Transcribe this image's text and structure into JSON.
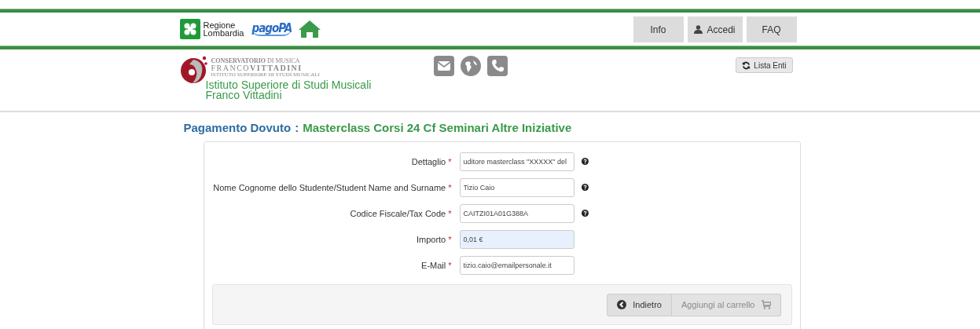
{
  "header": {
    "region_logo": {
      "line1": "Regione",
      "line2": "Lombardia"
    },
    "pagopa_logo": "pagoPA",
    "nav": [
      {
        "label": "Info",
        "kind": "text"
      },
      {
        "label": "Accedi",
        "kind": "user"
      },
      {
        "label": "FAQ",
        "kind": "text"
      }
    ]
  },
  "institution": {
    "logo_lines": [
      "**CONSERVATORIO** DI MUSICA",
      "FRANCO**VITTADINI**",
      "ISTITUTO SUPERIORE DI STUDI MUSICALI"
    ],
    "name_lines": [
      "Istituto Superiore di Studi Musicali",
      "Franco Vittadini"
    ],
    "contacts": [
      {
        "kind": "mail"
      },
      {
        "kind": "globe"
      },
      {
        "kind": "phone"
      }
    ],
    "list_button": "Lista Enti"
  },
  "title": {
    "prefix": "Pagamento Dovuto",
    "separator": ":",
    "name": "Masterclass Corsi 24 Cf Seminari Altre Iniziative"
  },
  "form": {
    "fields": [
      {
        "label": "Dettaglio",
        "required_mark": "*",
        "value": "uditore masterclass \"XXXXX\" del",
        "readonly": false,
        "help": true
      },
      {
        "label": "Nome Cognome dello Studente/Student Name and Surname",
        "required_mark": "*",
        "value": "Tizio Caio",
        "readonly": false,
        "help": true
      },
      {
        "label": "Codice Fiscale/Tax Code",
        "required_mark": "*",
        "value": "CAITZI01A01G388A",
        "readonly": false,
        "help": true
      },
      {
        "label": "Importo",
        "required_mark": "*",
        "value": "0,01 €",
        "readonly": true,
        "help": false
      },
      {
        "label": "E-Mail",
        "required_mark": "*",
        "value": "tizio.caio@emailpersonale.it",
        "readonly": false,
        "help": false
      }
    ],
    "buttons": [
      {
        "label": "Indietro",
        "kind": "back",
        "disabled": false
      },
      {
        "label": "Aggiungi al carrello",
        "kind": "cart",
        "disabled": true
      }
    ]
  }
}
